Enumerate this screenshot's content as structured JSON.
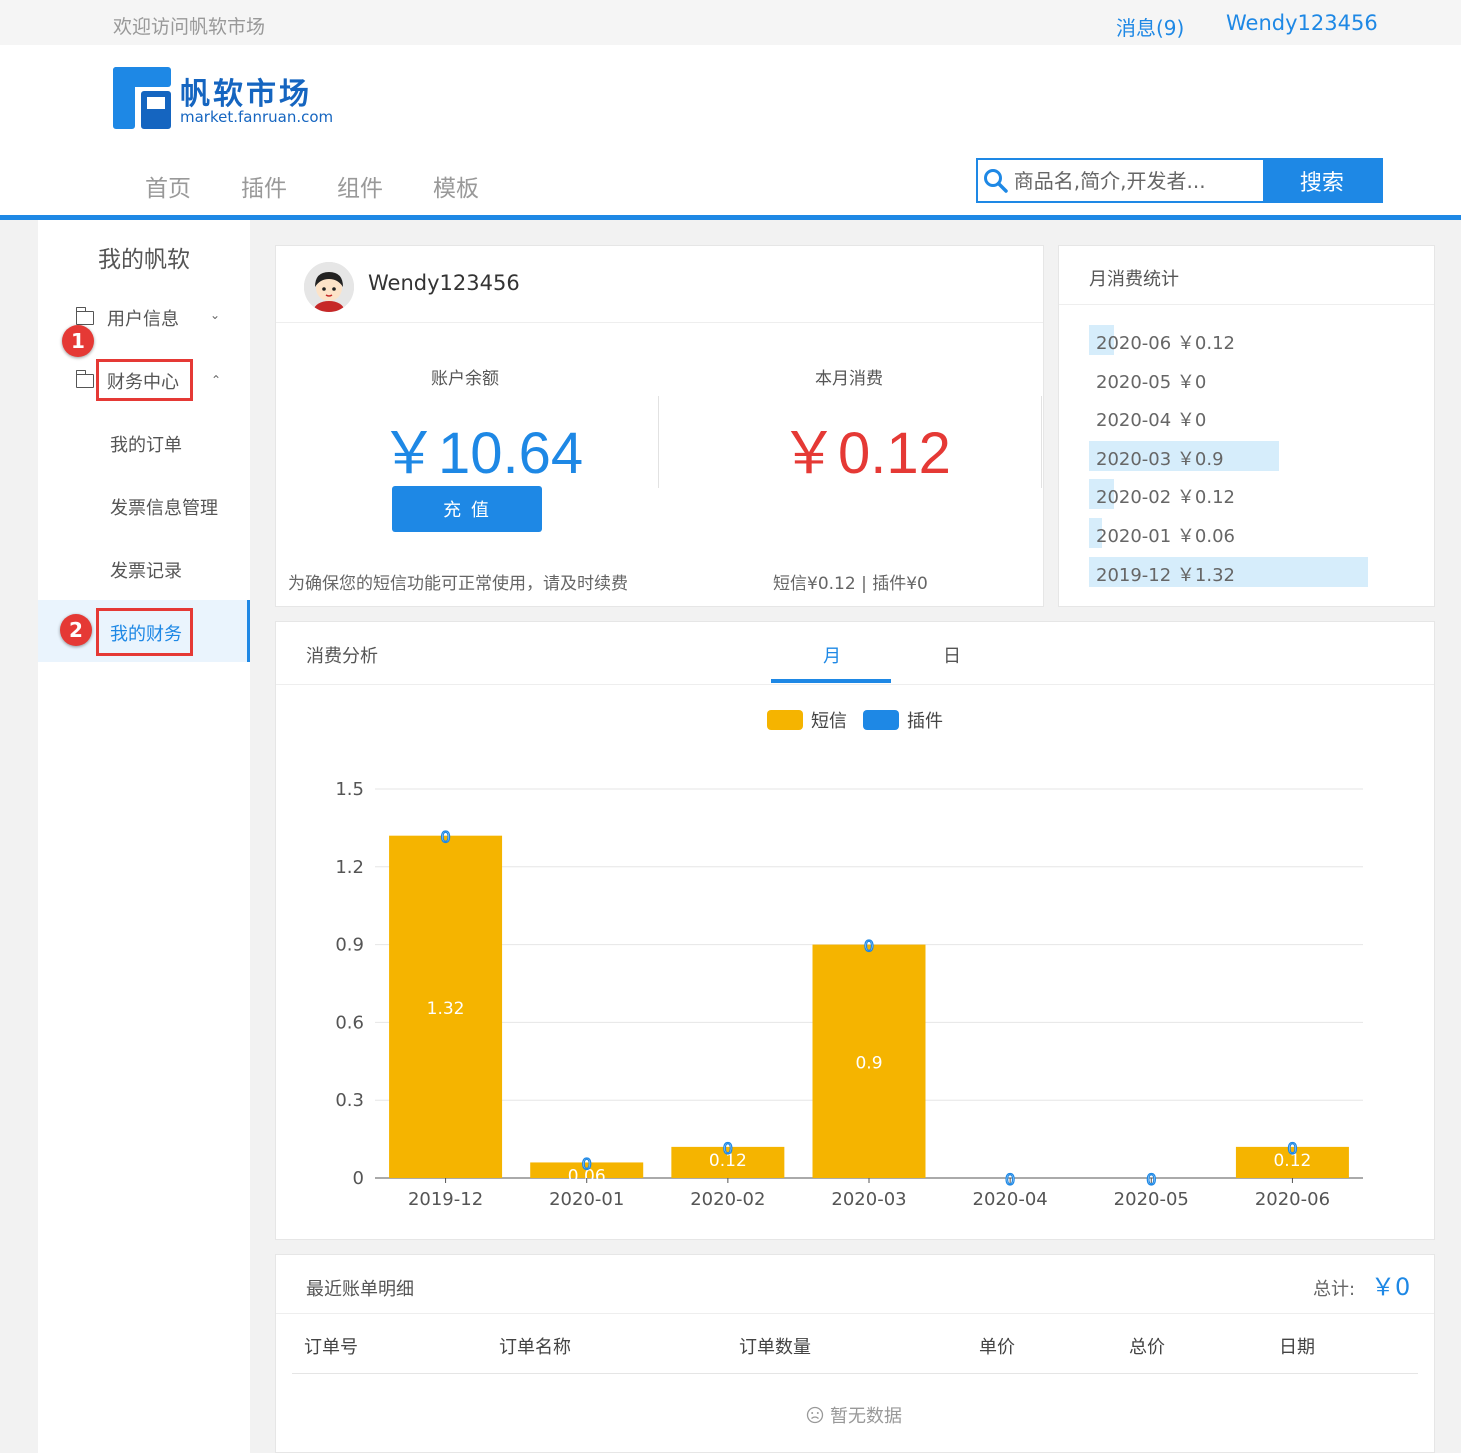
{
  "topbar": {
    "welcome": "欢迎访问帆软市场",
    "messages": "消息(9)",
    "username": "Wendy123456"
  },
  "logo": {
    "cn": "帆软市场",
    "en": "market.fanruan.com"
  },
  "nav": [
    "首页",
    "插件",
    "组件",
    "模板"
  ],
  "search": {
    "placeholder": "商品名,简介,开发者...",
    "button": "搜索"
  },
  "sidebar": {
    "title": "我的帆软",
    "groups": [
      {
        "label": "用户信息"
      },
      {
        "label": "财务中心"
      }
    ],
    "items": [
      {
        "label": "我的订单"
      },
      {
        "label": "发票信息管理"
      },
      {
        "label": "发票记录"
      },
      {
        "label": "我的财务"
      }
    ],
    "badges": [
      "1",
      "2"
    ]
  },
  "account": {
    "username": "Wendy123456",
    "balance_label": "账户余额",
    "balance": "￥10.64",
    "recharge": "充 值",
    "month_label": "本月消费",
    "month_value": "￥0.12",
    "note_left": "为确保您的短信功能可正常使用，请及时续费",
    "note_right": "短信¥0.12 | 插件¥0"
  },
  "monthly": {
    "title": "月消费统计",
    "rows": [
      {
        "text": "2020-06 ￥0.12",
        "amount": 0.12
      },
      {
        "text": "2020-05 ￥0",
        "amount": 0
      },
      {
        "text": "2020-04 ￥0",
        "amount": 0
      },
      {
        "text": "2020-03 ￥0.9",
        "amount": 0.9
      },
      {
        "text": "2020-02 ￥0.12",
        "amount": 0.12
      },
      {
        "text": "2020-01 ￥0.06",
        "amount": 0.06
      },
      {
        "text": "2019-12 ￥1.32",
        "amount": 1.32
      }
    ]
  },
  "analysis": {
    "title": "消费分析",
    "tab_month": "月",
    "tab_day": "日"
  },
  "chart_data": {
    "type": "bar",
    "categories": [
      "2019-12",
      "2020-01",
      "2020-02",
      "2020-03",
      "2020-04",
      "2020-05",
      "2020-06"
    ],
    "series": [
      {
        "name": "短信",
        "values": [
          1.32,
          0.06,
          0.12,
          0.9,
          0,
          0,
          0.12
        ],
        "labels": [
          "1.32",
          "0.06",
          "0.12",
          "0.9",
          "",
          "",
          "0.12"
        ]
      },
      {
        "name": "插件",
        "values": [
          0,
          0,
          0,
          0,
          0,
          0,
          0
        ],
        "labels": [
          "0",
          "0",
          "0",
          "0",
          "0",
          "0",
          "0"
        ]
      }
    ],
    "y_ticks": [
      "0",
      "0.3",
      "0.6",
      "0.9",
      "1.2",
      "1.5"
    ],
    "ylim": [
      0,
      1.5
    ],
    "stacked": true,
    "grid": true,
    "legend": "top-center",
    "colors": {
      "短信": "#f5b400",
      "插件": "#1e88e5"
    }
  },
  "bills": {
    "title": "最近账单明细",
    "total_label": "总计:",
    "total_value": "￥0",
    "columns": [
      "订单号",
      "订单名称",
      "订单数量",
      "单价",
      "总价",
      "日期"
    ],
    "empty": "暂无数据"
  },
  "colors": {
    "accent": "#1e88e5",
    "red": "#e53935",
    "bar": "#f5b400"
  }
}
